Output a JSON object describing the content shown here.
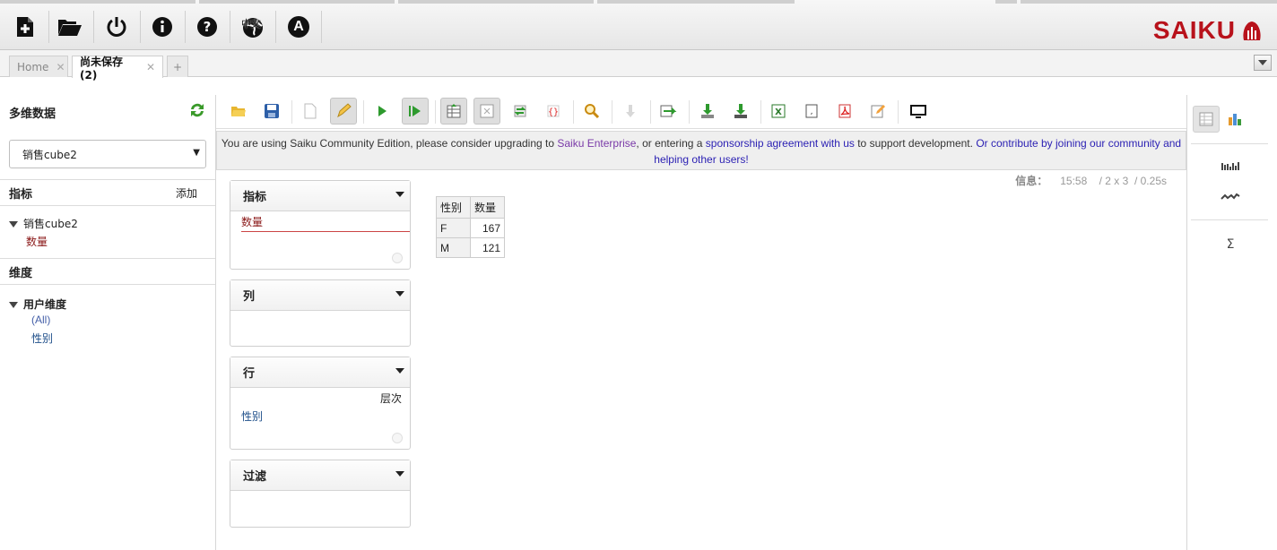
{
  "topbar": {
    "icons": [
      "new-query-icon",
      "open-query-icon",
      "logout-icon",
      "about-icon",
      "help-icon",
      "language-icon",
      "admin-icon"
    ],
    "language_icon_text": "中文",
    "admin_icon_text": "A",
    "brand": "SAIKU",
    "brand_color": "#b8121b"
  },
  "tabs": {
    "items": [
      {
        "label": "Home",
        "close": "✕"
      },
      {
        "label": "尚未保存 (2)",
        "close": "✕"
      }
    ],
    "add_label": "+"
  },
  "left_panel": {
    "title": "多维数据",
    "cube_selected": "销售cube2",
    "measures_header": "指标",
    "add_label": "添加",
    "measure_group": "销售cube2",
    "measure_item": "数量",
    "dimensions_header": "维度",
    "dimension_group": "用户维度",
    "dimension_items": [
      "(All)",
      "性别"
    ]
  },
  "notice": {
    "t1": "You are using Saiku Community Edition, please consider upgrading to ",
    "l1": "Saiku Enterprise",
    "t2": ", or entering a ",
    "l2": "sponsorship agreement with us",
    "t3": " to support development. ",
    "l3": "Or contribute by joining our community and helping other users!"
  },
  "info": {
    "label": "信息：",
    "time": "15:58",
    "dims": "/ 2 x 3",
    "dur": "/ 0.25s"
  },
  "drop_boxes": {
    "measures": {
      "title": "指标",
      "item": "数量"
    },
    "columns": {
      "title": "列"
    },
    "rows": {
      "title": "行",
      "tag": "层次",
      "item": "性别"
    },
    "filter": {
      "title": "过滤"
    }
  },
  "result_table": {
    "headers": [
      "性别",
      "数量"
    ],
    "rows": [
      [
        "F",
        "167"
      ],
      [
        "M",
        "121"
      ]
    ]
  },
  "right_panel": {
    "sigma": "Σ"
  }
}
